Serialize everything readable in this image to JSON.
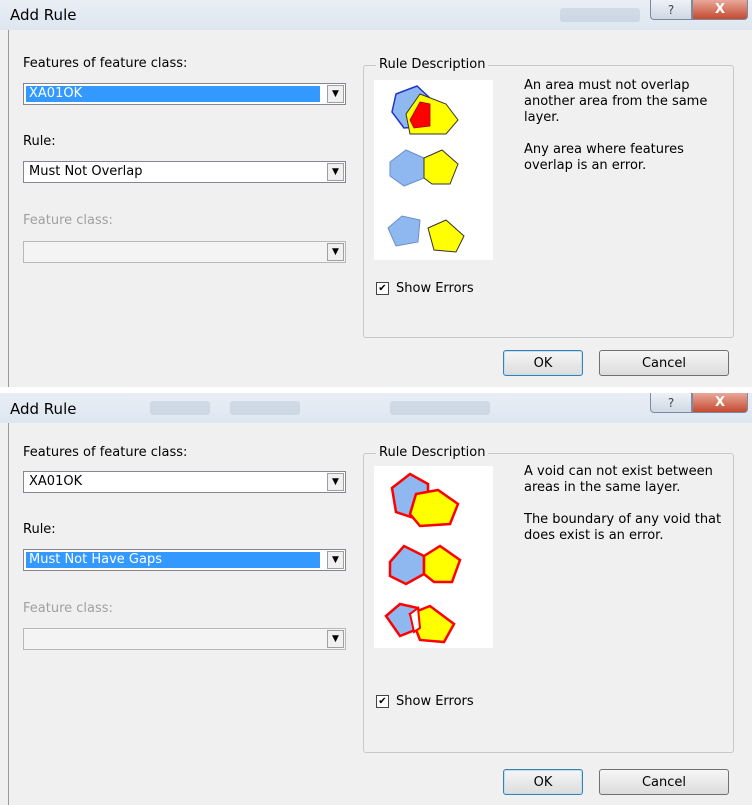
{
  "dialogs": [
    {
      "title": "Add Rule",
      "help_glyph": "?",
      "close_glyph": "X",
      "features_label": "Features of feature class:",
      "features_value": "XA01OK",
      "rule_label": "Rule:",
      "rule_value": "Must Not Overlap",
      "feature_class_label": "Feature class:",
      "feature_class_value": "",
      "group_label": "Rule Description",
      "description": [
        "An area must not overlap another area from the same layer.",
        "Any area where features overlap is an error."
      ],
      "show_errors_label": "Show Errors",
      "show_errors_checked": true,
      "ok_label": "OK",
      "cancel_label": "Cancel"
    },
    {
      "title": "Add Rule",
      "help_glyph": "?",
      "close_glyph": "X",
      "features_label": "Features of feature class:",
      "features_value": "XA01OK",
      "rule_label": "Rule:",
      "rule_value": "Must Not Have Gaps",
      "feature_class_label": "Feature class:",
      "feature_class_value": "",
      "group_label": "Rule Description",
      "description": [
        "A void can not exist between areas in the same layer.",
        "The boundary of any void that does exist is an error."
      ],
      "show_errors_label": "Show Errors",
      "show_errors_checked": true,
      "ok_label": "OK",
      "cancel_label": "Cancel"
    }
  ],
  "colors": {
    "polygon_blue": "#8fb8f0",
    "polygon_yellow": "#ffff00",
    "error_red": "#ff0000",
    "selection": "#3399ff"
  }
}
